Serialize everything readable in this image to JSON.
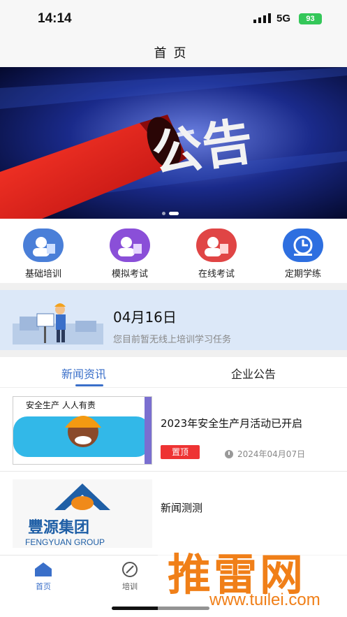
{
  "status_bar": {
    "time": "14:14",
    "network": "5G",
    "battery": "93"
  },
  "nav": {
    "title": "首页"
  },
  "banner": {
    "text": "公告"
  },
  "quick_menu": [
    {
      "label": "基础培训",
      "icon": "basic-training-icon",
      "color": "#4a7fd8"
    },
    {
      "label": "模拟考试",
      "icon": "mock-exam-icon",
      "color": "#8a4fd8"
    },
    {
      "label": "在线考试",
      "icon": "online-exam-icon",
      "color": "#e04545"
    },
    {
      "label": "定期学练",
      "icon": "regular-practice-icon",
      "color": "#2e6fe0"
    }
  ],
  "task_card": {
    "date": "04月16日",
    "description": "您目前暂无线上培训学习任务"
  },
  "tabs": {
    "news": "新闻资讯",
    "notice": "企业公告"
  },
  "news": [
    {
      "title": "2023年安全生产月活动已开启",
      "badge": "置顶",
      "date": "2024年04月07日",
      "thumb_caption": "安全生产 人人有责"
    },
    {
      "title": "新闻测测",
      "thumb_caption": "豐源集团",
      "thumb_caption_en": "FENGYUAN GROUP"
    }
  ],
  "tabbar": {
    "home": "首页",
    "train": "培训"
  },
  "watermark": {
    "text": "推雷网",
    "url": "www.tuilei.com"
  },
  "colors": {
    "accent": "#3a6fc9",
    "badge": "#e33333",
    "battery": "#34c759"
  }
}
